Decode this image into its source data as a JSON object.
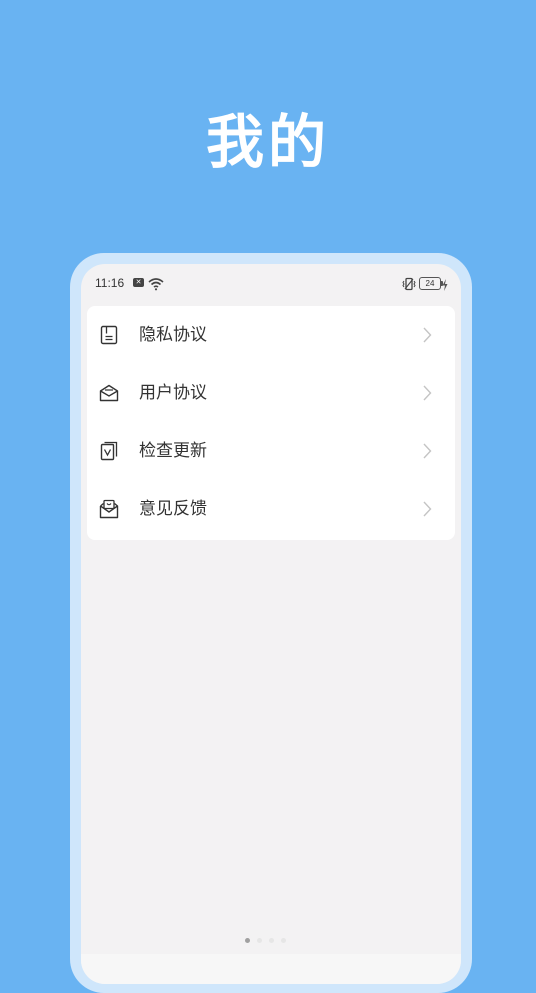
{
  "promo": {
    "title": "我的"
  },
  "status_bar": {
    "time": "11:16",
    "notification_badge": "✕",
    "battery_level": "24",
    "icons": [
      "notification-icon",
      "wifi-icon",
      "vibrate-icon",
      "battery-icon",
      "charging-icon"
    ]
  },
  "menu": {
    "items": [
      {
        "label": "隐私协议",
        "icon": "document-icon"
      },
      {
        "label": "用户协议",
        "icon": "envelope-icon"
      },
      {
        "label": "检查更新",
        "icon": "update-check-icon"
      },
      {
        "label": "意见反馈",
        "icon": "feedback-icon"
      }
    ]
  },
  "pager": {
    "active_index": 0,
    "count": 4
  },
  "colors": {
    "background": "#69b3f2",
    "frame": "#cfe6fb",
    "screen": "#f3f2f3",
    "card": "#ffffff",
    "text": "#333333",
    "chevron": "#c4c4c4"
  }
}
